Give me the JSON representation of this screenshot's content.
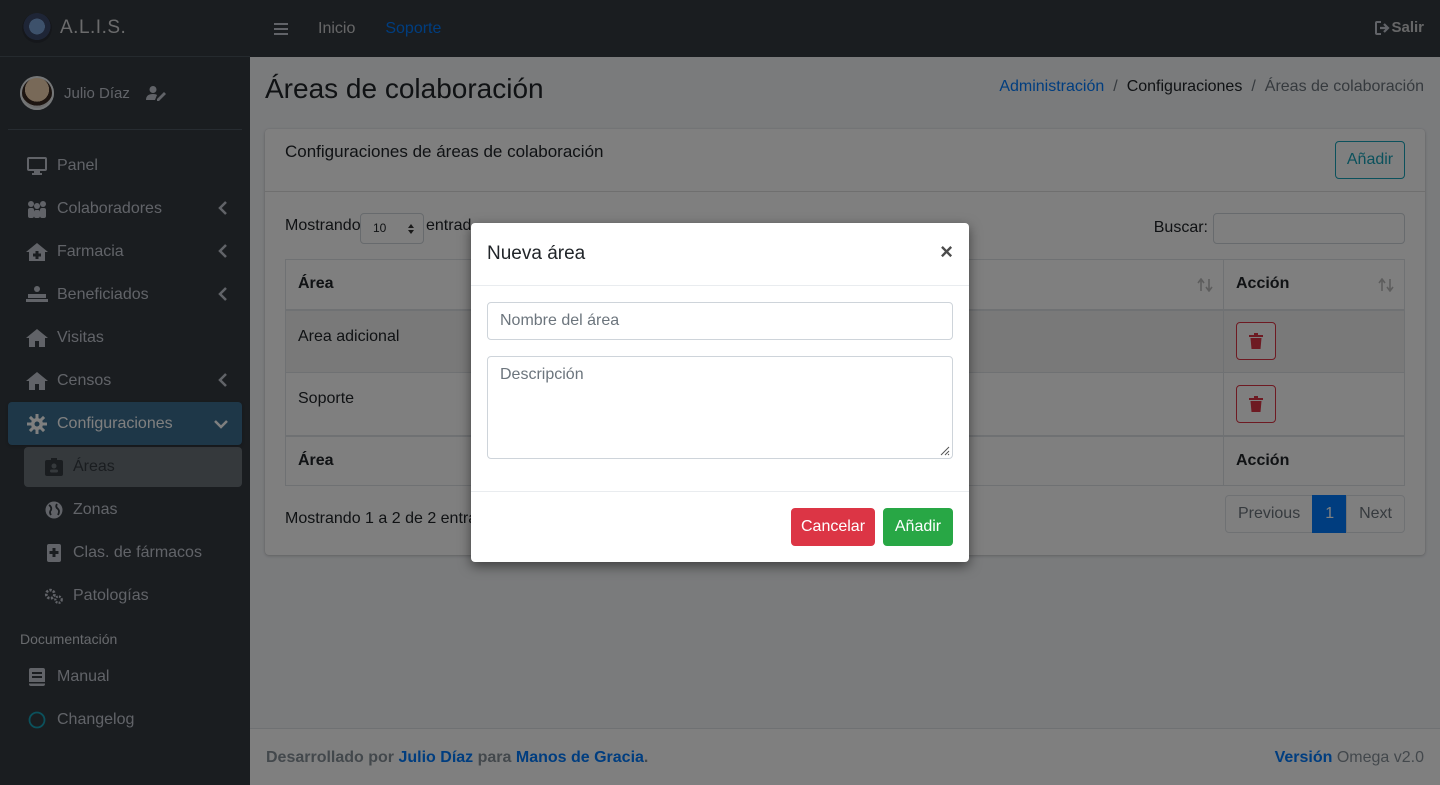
{
  "brand": {
    "name": "A.L.I.S."
  },
  "user": {
    "name": "Julio Díaz"
  },
  "sidebar": {
    "items": [
      {
        "label": "Panel",
        "icon": "desktop-icon"
      },
      {
        "label": "Colaboradores",
        "icon": "people-icon"
      },
      {
        "label": "Farmacia",
        "icon": "clinic-icon"
      },
      {
        "label": "Beneficiados",
        "icon": "procedures-icon"
      },
      {
        "label": "Visitas",
        "icon": "home-icon"
      },
      {
        "label": "Censos",
        "icon": "home-icon"
      },
      {
        "label": "Configuraciones",
        "icon": "gear-icon"
      }
    ],
    "sub_items": [
      {
        "label": "Áreas",
        "icon": "id-badge-icon"
      },
      {
        "label": "Zonas",
        "icon": "globe-icon"
      },
      {
        "label": "Clas. de fármacos",
        "icon": "medical-file-icon"
      },
      {
        "label": "Patologías",
        "icon": "cogs-icon"
      }
    ],
    "doc_header": "Documentación",
    "doc_items": [
      {
        "label": "Manual",
        "icon": "book-icon"
      },
      {
        "label": "Changelog",
        "icon": "circle-icon"
      }
    ]
  },
  "topbar": {
    "home": "Inicio",
    "support": "Soporte",
    "logout": "Salir"
  },
  "page": {
    "title": "Áreas de colaboración",
    "breadcrumb": [
      "Administración",
      "Configuraciones",
      "Áreas de colaboración"
    ]
  },
  "card": {
    "title": "Configuraciones de áreas de colaboración",
    "add_button": "Añadir",
    "length_label": "Mostrando",
    "length_value": "10",
    "length_after": "entrad",
    "search_label": "Buscar:",
    "columns": [
      "Área",
      "Acción"
    ],
    "rows": [
      {
        "area": "Area adicional"
      },
      {
        "area": "Soporte"
      }
    ],
    "info": "Mostrando 1 a 2 de 2 entrada",
    "pagination": {
      "previous": "Previous",
      "page": "1",
      "next": "Next"
    }
  },
  "footer": {
    "prefix": "Desarrollado por",
    "author": "Julio Díaz",
    "middle": "para",
    "org": "Manos de Gracia",
    "dot": ".",
    "version_label": "Versión",
    "version": "Omega v2.0"
  },
  "modal": {
    "title": "Nueva área",
    "close": "×",
    "name_placeholder": "Nombre del área",
    "desc_placeholder": "Descripción",
    "cancel": "Cancelar",
    "add": "Añadir"
  },
  "colors": {
    "primary": "#007bff",
    "danger": "#dc3545",
    "success": "#28a745",
    "info": "#17a2b8",
    "sidebar": "#343a40"
  }
}
